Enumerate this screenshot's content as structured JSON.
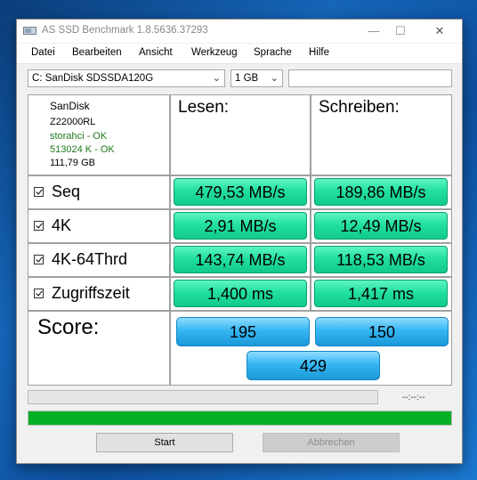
{
  "window": {
    "title": "AS SSD Benchmark 1.8.5636.37293",
    "minimize": "—",
    "maximize": "☐",
    "close": "✕"
  },
  "menu": [
    "Datei",
    "Bearbeiten",
    "Ansicht",
    "Werkzeug",
    "Sprache",
    "Hilfe"
  ],
  "toolbar": {
    "drive_select": "C: SanDisk SDSSDA120G",
    "size_select": "1 GB",
    "search_value": ""
  },
  "drive_info": {
    "vendor": "SanDisk",
    "firmware": "Z22000RL",
    "driver": "storahci - OK",
    "alignment": "513024 K - OK",
    "capacity": "111,79 GB"
  },
  "headers": {
    "read": "Lesen:",
    "write": "Schreiben:"
  },
  "rows": [
    {
      "label": "Seq",
      "read": "479,53 MB/s",
      "write": "189,86 MB/s"
    },
    {
      "label": "4K",
      "read": "2,91 MB/s",
      "write": "12,49 MB/s"
    },
    {
      "label": "4K-64Thrd",
      "read": "143,74 MB/s",
      "write": "118,53 MB/s"
    },
    {
      "label": "Zugriffszeit",
      "read": "1,400 ms",
      "write": "1,417 ms"
    }
  ],
  "score": {
    "label": "Score:",
    "read": "195",
    "write": "150",
    "total": "429"
  },
  "progress": {
    "test_progress": 0,
    "total_progress": 100,
    "time": "--:--:--"
  },
  "buttons": {
    "start": "Start",
    "abort": "Abbrechen"
  },
  "colors": {
    "result_green": "#22e0a0",
    "score_blue": "#35b6f2",
    "progress_green": "#06b025"
  }
}
